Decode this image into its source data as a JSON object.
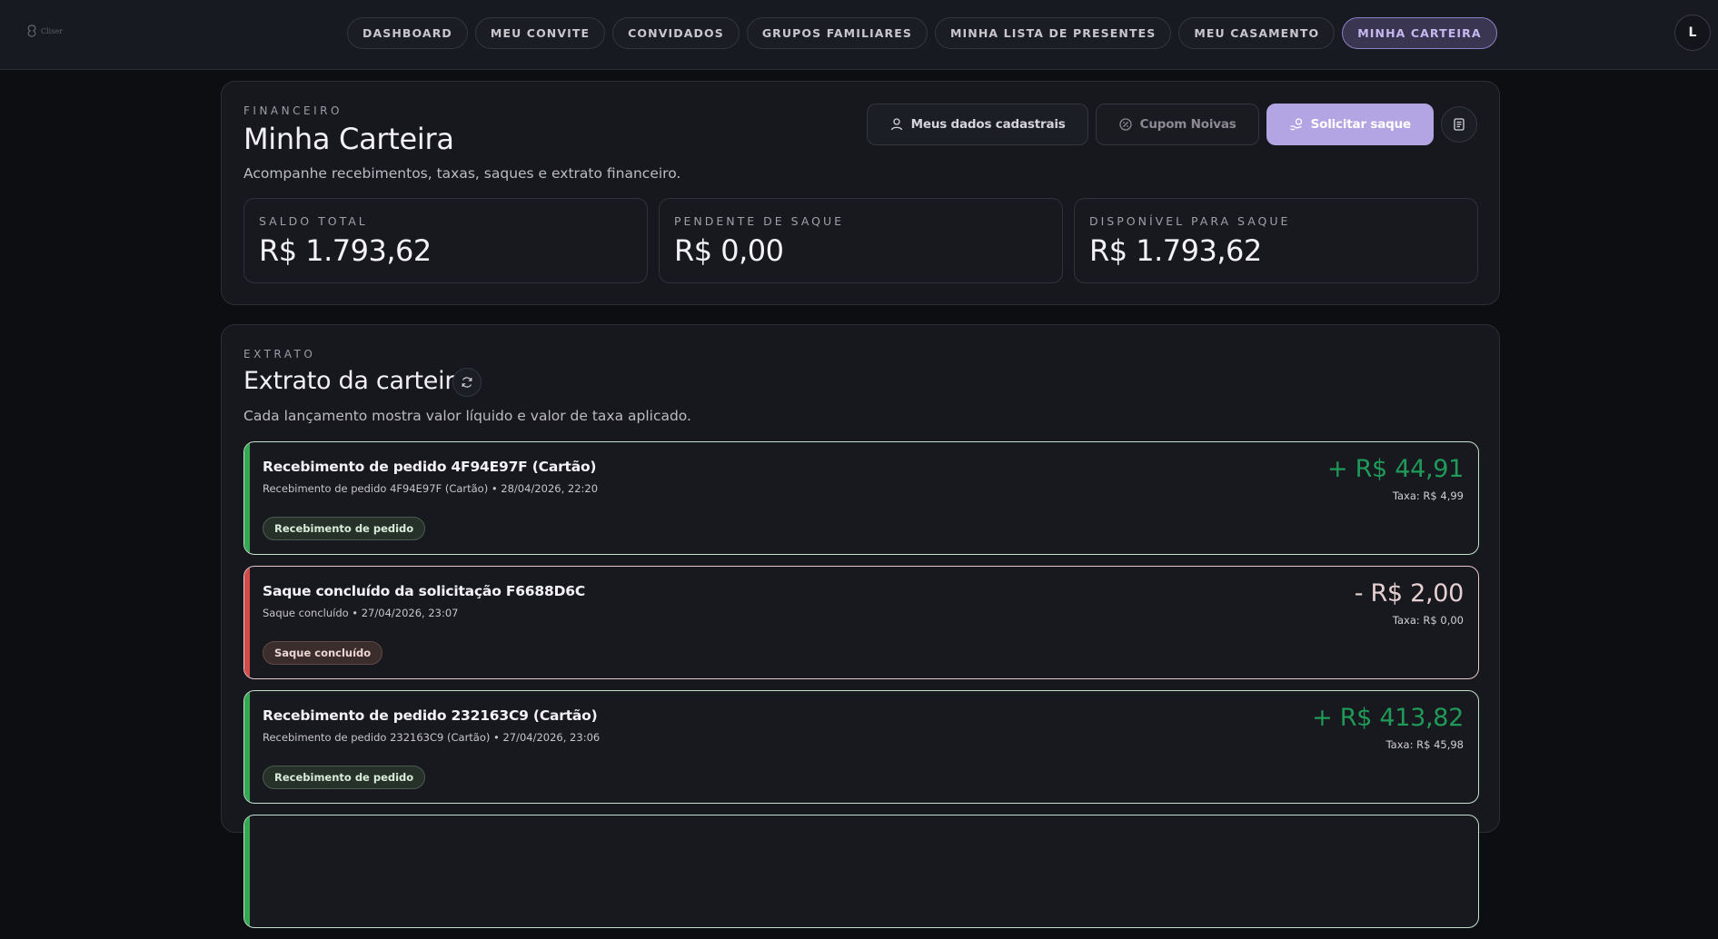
{
  "brand": {
    "logo_text": "Cliser"
  },
  "nav": {
    "items": [
      {
        "label": "DASHBOARD",
        "active": false
      },
      {
        "label": "MEU CONVITE",
        "active": false
      },
      {
        "label": "CONVIDADOS",
        "active": false
      },
      {
        "label": "GRUPOS FAMILIARES",
        "active": false
      },
      {
        "label": "MINHA LISTA DE PRESENTES",
        "active": false
      },
      {
        "label": "MEU CASAMENTO",
        "active": false
      },
      {
        "label": "MINHA CARTEIRA",
        "active": true
      }
    ],
    "avatar_initial": "L"
  },
  "financeiro": {
    "eyebrow": "FINANCEIRO",
    "title": "Minha Carteira",
    "subtitle": "Acompanhe recebimentos, taxas, saques e extrato financeiro.",
    "actions": {
      "profile_label": "Meus dados cadastrais",
      "coupon_label": "Cupom Noivas",
      "withdraw_label": "Solicitar saque"
    },
    "stats": [
      {
        "label": "SALDO TOTAL",
        "value": "R$ 1.793,62"
      },
      {
        "label": "PENDENTE DE SAQUE",
        "value": "R$ 0,00"
      },
      {
        "label": "DISPONÍVEL PARA SAQUE",
        "value": "R$ 1.793,62"
      }
    ]
  },
  "extrato": {
    "eyebrow": "EXTRATO",
    "title": "Extrato da carteira",
    "subtitle": "Cada lançamento mostra valor líquido e valor de taxa aplicado.",
    "transactions": [
      {
        "type": "in",
        "title": "Recebimento de pedido 4F94E97F (Cartão)",
        "meta": "Recebimento de pedido 4F94E97F (Cartão) • 28/04/2026, 22:20",
        "badge": "Recebimento de pedido",
        "amount": "+ R$ 44,91",
        "fee": "Taxa: R$ 4,99"
      },
      {
        "type": "out",
        "title": "Saque concluído da solicitação F6688D6C",
        "meta": "Saque concluído • 27/04/2026, 23:07",
        "badge": "Saque concluído",
        "amount": "- R$ 2,00",
        "fee": "Taxa: R$ 0,00"
      },
      {
        "type": "in",
        "title": "Recebimento de pedido 232163C9 (Cartão)",
        "meta": "Recebimento de pedido 232163C9 (Cartão) • 27/04/2026, 23:06",
        "badge": "Recebimento de pedido",
        "amount": "+ R$ 413,82",
        "fee": "Taxa: R$ 45,98"
      },
      {
        "type": "in",
        "title": "",
        "meta": "",
        "badge": "",
        "amount": "",
        "fee": ""
      }
    ]
  },
  "colors": {
    "accent": "#b3a4e3",
    "incoming": "#1f9a58",
    "outgoing_bar": "#d14b4b",
    "incoming_bar": "#34a853"
  }
}
